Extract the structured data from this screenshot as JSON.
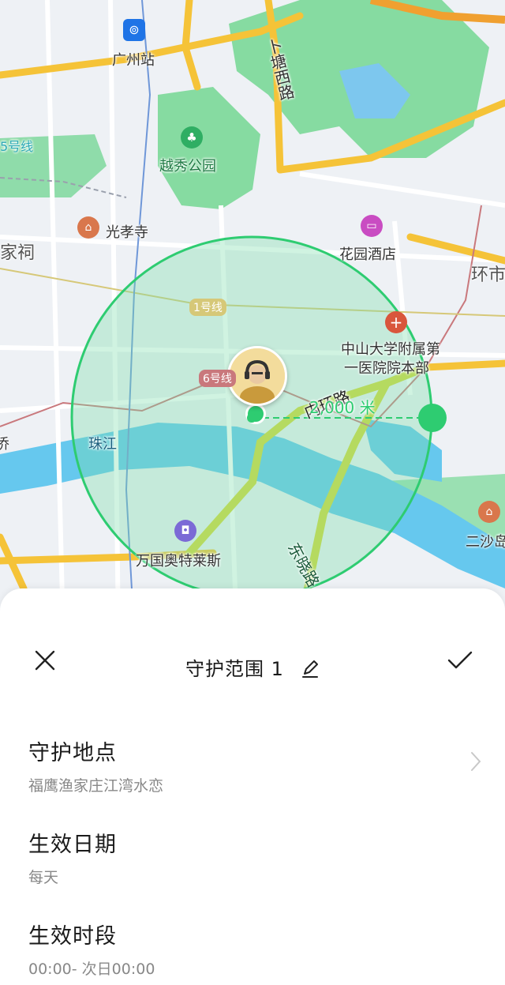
{
  "map": {
    "labels": {
      "guangzhou_station": "广州站",
      "line5": "5号线",
      "kaitang_road": "卜塘西路",
      "yuexiu_park": "越秀公园",
      "guangxiao_temple": "光孝寺",
      "family_temple": "家祠",
      "garden_hotel": "花园酒店",
      "ring_road_right": "环市",
      "line1": "1号线",
      "line6": "6号线",
      "hospital": "中山大学附属第一医院院本部",
      "hospital_line1": "中山大学附属第",
      "hospital_line2": "一医院院本部",
      "inner_ring": "内环路",
      "distance": "2,000 米",
      "pearl_river": "珠江",
      "outlet": "万国奥特莱斯",
      "ershadao": "二沙岛",
      "dongxiao_road": "东晓路",
      "left_edge": "侨"
    },
    "colors": {
      "fence_circle": "#2ecc71",
      "fence_fill": "rgba(120,220,170,0.35)",
      "river": "#66c8ee",
      "park": "#86dba1",
      "road": "#f5c338"
    }
  },
  "sheet": {
    "title": "守护范围 1",
    "rows": [
      {
        "label": "守护地点",
        "value": "福鹰渔家庄江湾水恋"
      },
      {
        "label": "生效日期",
        "value": "每天"
      },
      {
        "label": "生效时段",
        "value": "00:00- 次日00:00"
      }
    ]
  }
}
